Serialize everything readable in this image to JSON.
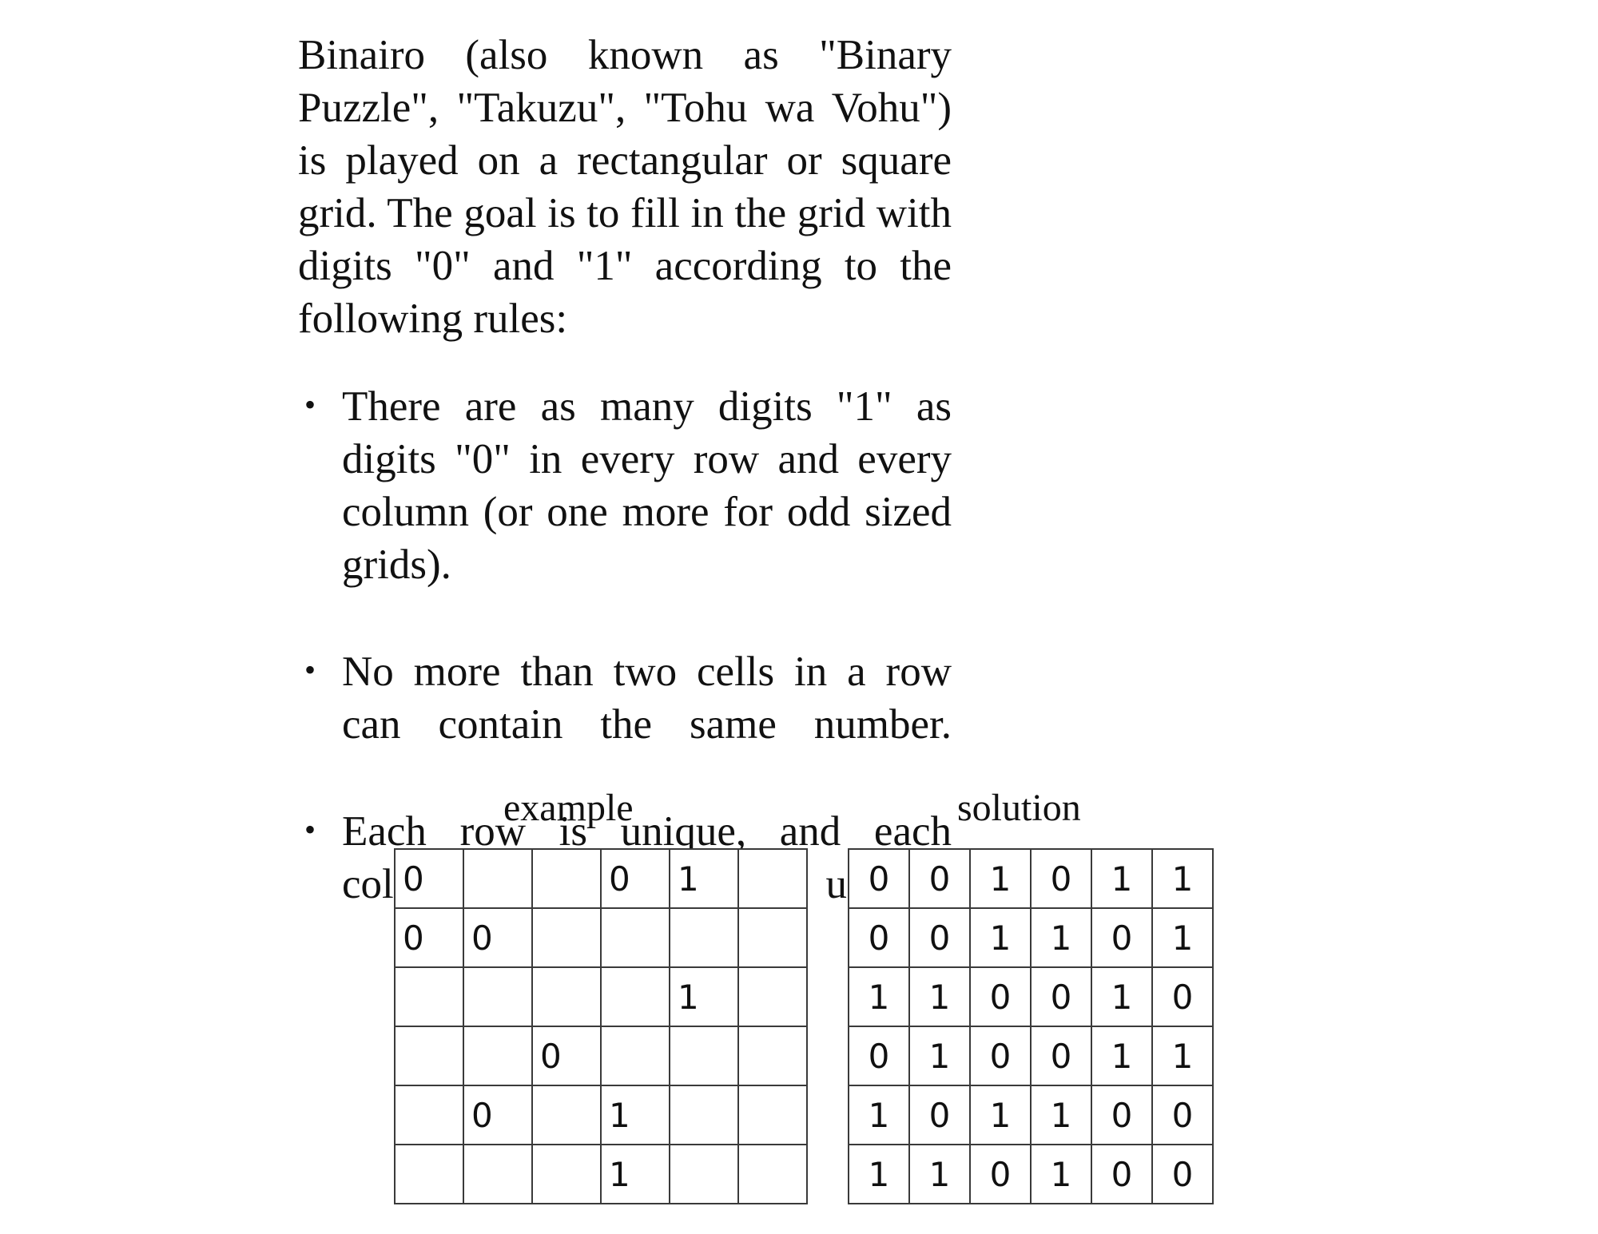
{
  "document": {
    "intro_paragraph": "Binairo (also known as \"Binary Puzzle\", \"Takuzu\", \"Tohu wa Vohu\") is played on a rectangular or square grid. The goal is to fill in the grid with digits \"0\" and \"1\" according to the following rules:",
    "rules": [
      "There are as many digits \"1\" as digits \"0\" in every row and every column (or one more for odd sized grids).",
      "No more than two cells in a row can contain the same number.",
      "Each row is unique, and each column is unique."
    ],
    "bullet_glyph": "•"
  },
  "puzzle": {
    "example": {
      "caption": "example",
      "rows": 6,
      "cols": 6,
      "cells": [
        [
          "0",
          "",
          "",
          "0",
          "1",
          ""
        ],
        [
          "0",
          "0",
          "",
          "",
          "",
          ""
        ],
        [
          "",
          "",
          "",
          "",
          "1",
          ""
        ],
        [
          "",
          "",
          "0",
          "",
          "",
          ""
        ],
        [
          "",
          "0",
          "",
          "1",
          "",
          ""
        ],
        [
          "",
          "",
          "",
          "1",
          "",
          ""
        ]
      ]
    },
    "solution": {
      "caption": "solution",
      "rows": 6,
      "cols": 6,
      "cells": [
        [
          "0",
          "0",
          "1",
          "0",
          "1",
          "1"
        ],
        [
          "0",
          "0",
          "1",
          "1",
          "0",
          "1"
        ],
        [
          "1",
          "1",
          "0",
          "0",
          "1",
          "0"
        ],
        [
          "0",
          "1",
          "0",
          "0",
          "1",
          "1"
        ],
        [
          "1",
          "0",
          "1",
          "1",
          "0",
          "0"
        ],
        [
          "1",
          "1",
          "0",
          "1",
          "0",
          "0"
        ]
      ]
    }
  },
  "colors": {
    "page_background": "#ffffff",
    "text": "#111111",
    "grid_line": "#3a3a3a"
  }
}
